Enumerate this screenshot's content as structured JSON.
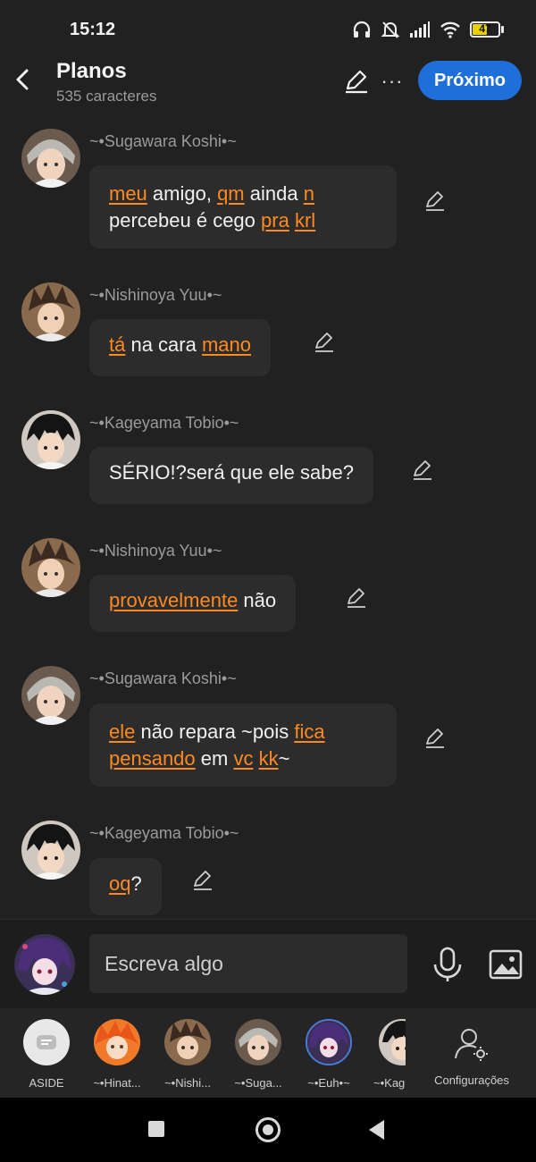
{
  "status_bar": {
    "time": "15:12",
    "battery": "47",
    "icons": [
      "headphones-icon",
      "bell-muted-icon",
      "signal-icon",
      "wifi-icon",
      "battery-icon"
    ]
  },
  "header": {
    "title": "Planos",
    "subtitle": "535 caracteres",
    "next_label": "Próximo",
    "more_label": "···"
  },
  "messages": [
    {
      "sender": "~•Sugawara Koshi•~",
      "lines": [
        [
          {
            "t": "meu",
            "h": true
          },
          {
            "t": " amigo, ",
            "h": false
          },
          {
            "t": "qm",
            "h": true
          },
          {
            "t": " ainda ",
            "h": false
          },
          {
            "t": "n",
            "h": true
          }
        ],
        [
          {
            "t": "percebeu é cego ",
            "h": false
          },
          {
            "t": "pra",
            "h": true
          },
          {
            "t": " ",
            "h": false
          },
          {
            "t": "krl",
            "h": true
          }
        ]
      ]
    },
    {
      "sender": "~•Nishinoya Yuu•~",
      "lines": [
        [
          {
            "t": "tá",
            "h": true
          },
          {
            "t": " na cara ",
            "h": false
          },
          {
            "t": "mano",
            "h": true
          }
        ]
      ]
    },
    {
      "sender": "~•Kageyama Tobio•~",
      "lines": [
        [
          {
            "t": "SÉRIO!?será que ele sabe?",
            "h": false
          }
        ]
      ]
    },
    {
      "sender": "~•Nishinoya Yuu•~",
      "lines": [
        [
          {
            "t": "provavelmente",
            "h": true
          },
          {
            "t": " não",
            "h": false
          }
        ]
      ]
    },
    {
      "sender": "~•Sugawara Koshi•~",
      "lines": [
        [
          {
            "t": "ele",
            "h": true
          },
          {
            "t": " não repara ~pois ",
            "h": false
          },
          {
            "t": "fica",
            "h": true
          }
        ],
        [
          {
            "t": "pensando",
            "h": true
          },
          {
            "t": " em ",
            "h": false
          },
          {
            "t": "vc",
            "h": true
          },
          {
            "t": " ",
            "h": false
          },
          {
            "t": "kk",
            "h": true
          },
          {
            "t": "~",
            "h": false
          }
        ]
      ]
    },
    {
      "sender": "~•Kageyama Tobio•~",
      "lines": [
        [
          {
            "t": "oq",
            "h": true
          },
          {
            "t": "?",
            "h": false
          }
        ]
      ]
    }
  ],
  "compose": {
    "placeholder": "Escreva algo"
  },
  "characters": [
    {
      "label": "ASIDE"
    },
    {
      "label": "~•Hinat..."
    },
    {
      "label": "~•Nishi..."
    },
    {
      "label": "~•Suga..."
    },
    {
      "label": "~•Euh•~"
    },
    {
      "label": "~•Kag"
    }
  ],
  "config_label": "Configurações",
  "colors": {
    "accent": "#ff8a20",
    "button": "#1e6fd9",
    "bubble": "#2c2c2c",
    "background": "#212121"
  }
}
